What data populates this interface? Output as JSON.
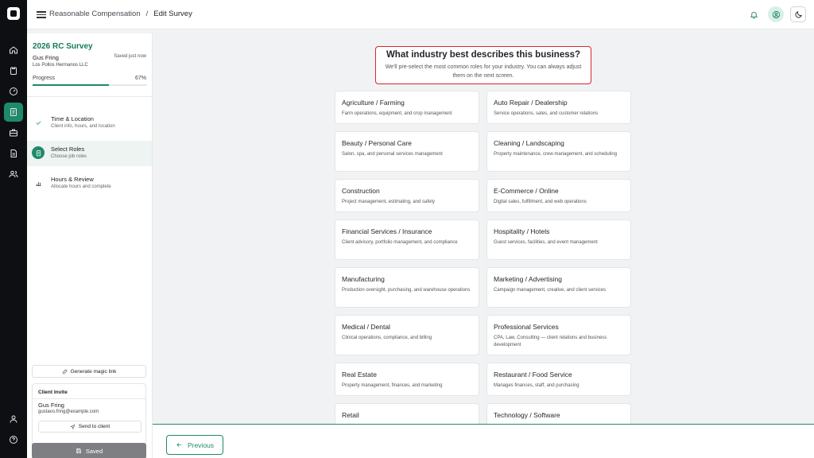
{
  "header": {
    "breadcrumb": [
      "Reasonable Compensation",
      "/",
      "Edit Survey"
    ]
  },
  "survey": {
    "title": "2026 RC Survey",
    "person": "Gus Fring",
    "company": "Los Pollos Hermanos LLC",
    "save_status": "Saved just now",
    "progress_label": "Progress",
    "progress_value": "67%",
    "progress_fraction": 0.67
  },
  "steps": [
    {
      "title": "Time & Location",
      "sub": "Client info, hours, and location",
      "state": "done",
      "icon": "check-icon"
    },
    {
      "title": "Select Roles",
      "sub": "Choose job roles",
      "state": "current",
      "icon": "clipboard-icon"
    },
    {
      "title": "Hours & Review",
      "sub": "Allocate hours and complete",
      "state": "todo",
      "icon": "bar-chart-icon"
    }
  ],
  "sidebar_actions": {
    "magic_link": "Generate magic link",
    "invite_title": "Client Invite",
    "invite_name": "Gus Fring",
    "invite_email": "gustavo.fring@example.com",
    "send_label": "Send to client",
    "saved_label": "Saved"
  },
  "question": {
    "title": "What industry best describes this business?",
    "subtitle": "We'll pre-select the most common roles for your industry. You can always adjust them on the next screen."
  },
  "industries": [
    {
      "title": "Agriculture / Farming",
      "desc": "Farm operations, equipment, and crop management"
    },
    {
      "title": "Auto Repair / Dealership",
      "desc": "Service operations, sales, and customer relations"
    },
    {
      "title": "Beauty / Personal Care",
      "desc": "Salon, spa, and personal services management"
    },
    {
      "title": "Cleaning / Landscaping",
      "desc": "Property maintenance, crew management, and scheduling"
    },
    {
      "title": "Construction",
      "desc": "Project management, estimating, and safety"
    },
    {
      "title": "E-Commerce / Online",
      "desc": "Digital sales, fulfillment, and web operations"
    },
    {
      "title": "Financial Services / Insurance",
      "desc": "Client advisory, portfolio management, and compliance"
    },
    {
      "title": "Hospitality / Hotels",
      "desc": "Guest services, facilities, and event management"
    },
    {
      "title": "Manufacturing",
      "desc": "Production oversight, purchasing, and warehouse operations"
    },
    {
      "title": "Marketing / Advertising",
      "desc": "Campaign management, creative, and client services"
    },
    {
      "title": "Medical / Dental",
      "desc": "Clinical operations, compliance, and billing"
    },
    {
      "title": "Professional Services",
      "desc": "CPA, Law, Consulting — client relations and business development"
    },
    {
      "title": "Real Estate",
      "desc": "Property management, finances, and marketing"
    },
    {
      "title": "Restaurant / Food Service",
      "desc": "Manages finances, staff, and purchasing"
    },
    {
      "title": "Retail",
      "desc": ""
    },
    {
      "title": "Technology / Software",
      "desc": ""
    }
  ],
  "footer": {
    "previous_label": "Previous"
  },
  "colors": {
    "accent": "#1e8a6a",
    "highlight_border": "#d8262f",
    "rail": "#0d0f12"
  }
}
